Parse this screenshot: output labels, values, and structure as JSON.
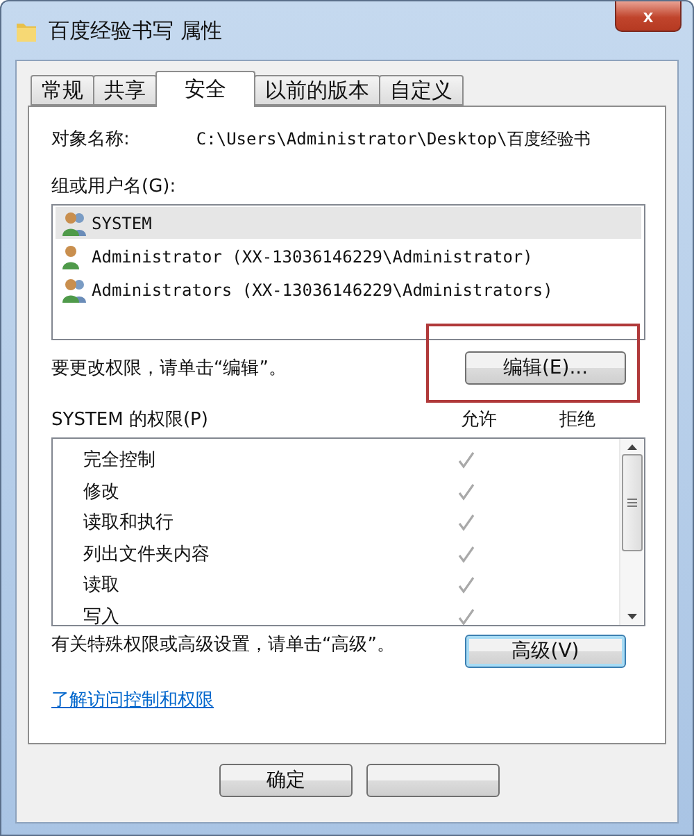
{
  "window": {
    "title": "百度经验书写 属性",
    "close": "x"
  },
  "tabs": [
    {
      "label": "常规",
      "selected": false
    },
    {
      "label": "共享",
      "selected": false
    },
    {
      "label": "安全",
      "selected": true
    },
    {
      "label": "以前的版本",
      "selected": false
    },
    {
      "label": "自定义",
      "selected": false
    }
  ],
  "object_name": {
    "label": "对象名称:",
    "value": "C:\\Users\\Administrator\\Desktop\\百度经验书"
  },
  "users": {
    "label": "组或用户名(G):",
    "items": [
      {
        "kind": "group",
        "name": "SYSTEM",
        "selected": true
      },
      {
        "kind": "user",
        "name": "Administrator (XX-13036146229\\Administrator)",
        "selected": false
      },
      {
        "kind": "group",
        "name": "Administrators (XX-13036146229\\Administrators)",
        "selected": false
      }
    ]
  },
  "edit_hint": "要更改权限，请单击“编辑”。",
  "edit_button": "编辑(E)...",
  "permissions": {
    "label": "SYSTEM 的权限(P)",
    "allow_header": "允许",
    "deny_header": "拒绝",
    "items": [
      {
        "name": "完全控制",
        "allow": true,
        "deny": false
      },
      {
        "name": "修改",
        "allow": true,
        "deny": false
      },
      {
        "name": "读取和执行",
        "allow": true,
        "deny": false
      },
      {
        "name": "列出文件夹内容",
        "allow": true,
        "deny": false
      },
      {
        "name": "读取",
        "allow": true,
        "deny": false
      },
      {
        "name": "写入",
        "allow": true,
        "deny": false
      }
    ]
  },
  "advanced_hint": "有关特殊权限或高级设置，请单击“高级”。",
  "advanced_button": "高级(V)",
  "link": "了解访问控制和权限",
  "buttons": [
    "确定"
  ]
}
